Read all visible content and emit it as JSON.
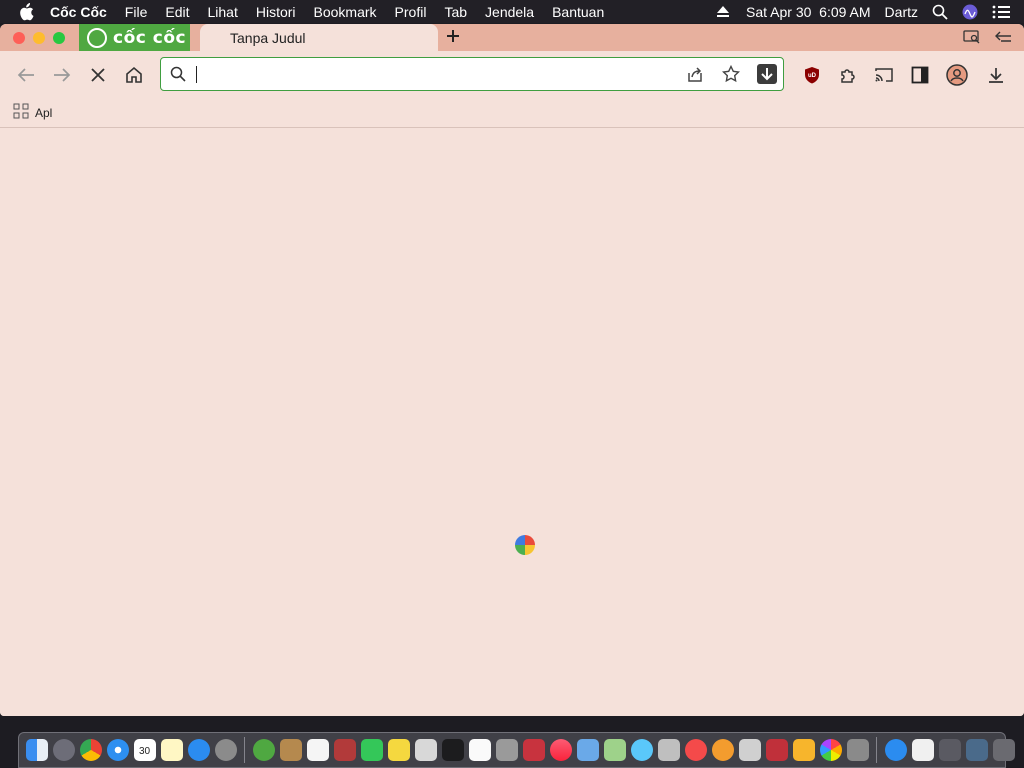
{
  "menubar": {
    "app_name": "Cốc Cốc",
    "items": [
      "File",
      "Edit",
      "Lihat",
      "Histori",
      "Bookmark",
      "Profil",
      "Tab",
      "Jendela",
      "Bantuan"
    ],
    "datetime": "Sat Apr 30  6:09 AM",
    "user": "Dartz"
  },
  "browser": {
    "brand": "cốc cốc",
    "tab_title": "Tanpa Judul",
    "new_tab_icon": "plus-icon",
    "address": {
      "value": "",
      "placeholder": ""
    },
    "bookmarks": [
      {
        "label": "Apl",
        "icon": "apps-grid-icon"
      }
    ],
    "status": "loading",
    "accent_color": "#3f9e40",
    "tabstrip_color": "#e7b09e",
    "page_color": "#f5e1da"
  },
  "dock": {
    "apps": [
      "finder",
      "launchpad",
      "chrome",
      "safari",
      "calendar",
      "notes",
      "app-store",
      "system-preferences",
      "coc-coc",
      "contacts",
      "reminders",
      "dictionary",
      "facetime",
      "stickies",
      "font-book",
      "stocks",
      "textedit",
      "disk-utility",
      "mission-control",
      "music",
      "preview",
      "maps",
      "messages",
      "automator",
      "news",
      "books",
      "files",
      "photo-booth",
      "home",
      "photos",
      "migration-assistant"
    ],
    "right_items": [
      "app-store-downloads",
      "document",
      "grid-folder",
      "screenshot-folder",
      "trash"
    ],
    "calendar_day": "30"
  }
}
